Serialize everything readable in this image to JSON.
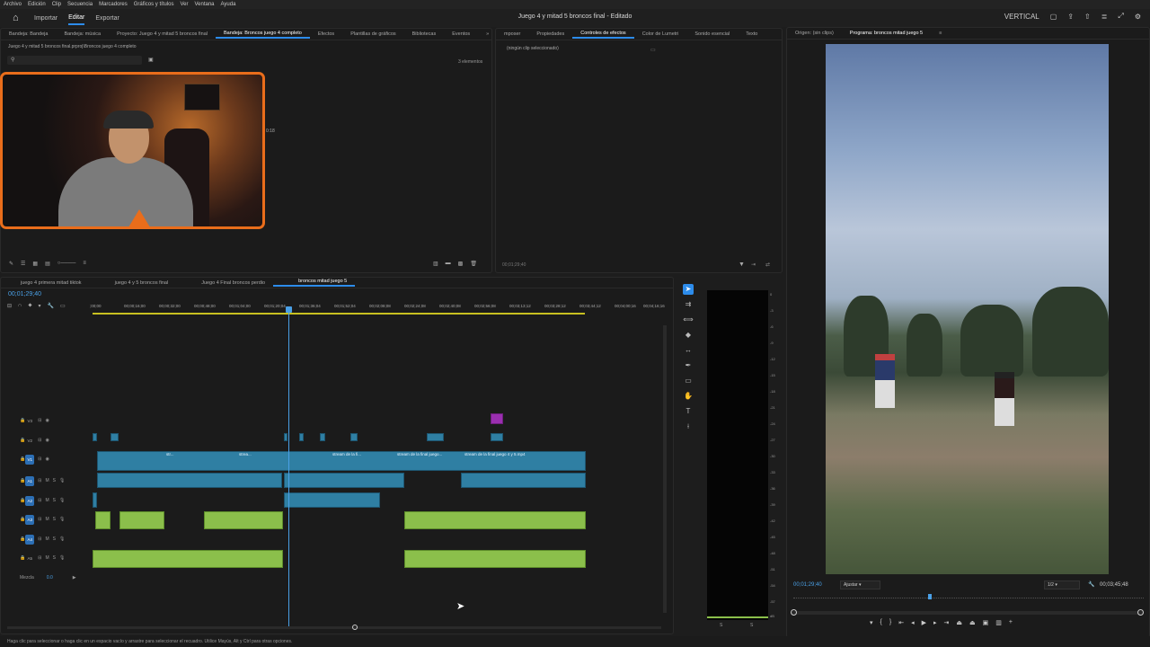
{
  "menu": [
    "Archivo",
    "Edición",
    "Clip",
    "Secuencia",
    "Marcadores",
    "Gráficos y títulos",
    "Ver",
    "Ventana",
    "Ayuda"
  ],
  "workspaces": {
    "import": "Importar",
    "edit": "Editar",
    "export": "Exportar"
  },
  "document_title": "Juego 4 y mitad 5 broncos final - Editado",
  "top_right": {
    "layout": "VERTICAL"
  },
  "project_tabs": [
    "Bandeja: Bandeja",
    "Bandeja: música",
    "Proyecto: Juego 4 y mitad 5 broncos final",
    "Bandeja: Broncos juego 4 completo",
    "Efectos",
    "Plantillas de gráficos",
    "Bibliotecas",
    "Eventos"
  ],
  "project_path": "Juego 4 y mitad 5 broncos final.prproj\\Broncos juego 4 completo",
  "project_count": "3 elementos",
  "bin_clip_duration": "0:18",
  "effect_tabs": [
    "mposer",
    "Propiedades",
    "Controles de efectos",
    "Color de Lumetri",
    "Sonido esencial",
    "Texto"
  ],
  "effect_empty": "(ningún clip seleccionado)",
  "effect_timecode": "00;01;29;40",
  "program_tabs": {
    "source": "Origen: (sin clips)",
    "program": "Programa: broncos mitad juego 5"
  },
  "sequence_tabs": [
    "juego 4 primera mitad tiktok",
    "juego 4 y 5 broncos final",
    "Juego 4 Final broncos perdio",
    "broncos mitad juego 5"
  ],
  "timeline_timecode": "00;01;29;40",
  "ruler_labels": [
    ";00;00",
    "00;00;16;00",
    "00;00;32;00",
    "00;00;48;00",
    "00;01;04;00",
    "00;01;20;04",
    "00;01;36;04",
    "00;01;52;04",
    "00;02;08;08",
    "00;02;24;08",
    "00;02;40;08",
    "00;02;56;08",
    "00;03;13;12",
    "00;03;28;12",
    "00;03;44;12",
    "00;04;00;16",
    "00;04;16;16"
  ],
  "tracks": {
    "v3": "V3",
    "v2": "V2",
    "v1": "V1",
    "a1": "A1",
    "a2": "A2",
    "a3": "A3",
    "a4": "A4",
    "a5": "A5",
    "mix": "Mezcla",
    "mix_value": "0.0"
  },
  "clip_labels": [
    "str...",
    "strea...",
    "stream de la fi...",
    "stream de la final juego...",
    "stream de la final juego 4 y 5.mp4"
  ],
  "meter_scale": [
    "0",
    "-3",
    "-6",
    "-9",
    "-12",
    "-15",
    "-18",
    "-21",
    "-24",
    "-27",
    "-30",
    "-33",
    "-36",
    "-39",
    "-42",
    "-45",
    "-48",
    "-51",
    "-54",
    "-57",
    "dB"
  ],
  "meter_bottom": {
    "left": "S",
    "right": "S"
  },
  "program": {
    "timecode": "00;01;29;40",
    "fit": "Ajustar",
    "resolution": "1/2",
    "duration": "00;03;45;48"
  },
  "status": "Haga clic para seleccionar o haga clic en un espacio vacío y arrastre para seleccionar el recuadro. Utilice Mayús, Alt y Ctrl para otras opciones.",
  "colors": {
    "accent": "#2d8ceb",
    "video_clip": "#2f7fa3",
    "audio_clip": "#8bbf4b",
    "graphic_clip": "#9b2fb0",
    "webcam_frame": "#e96d1b"
  }
}
